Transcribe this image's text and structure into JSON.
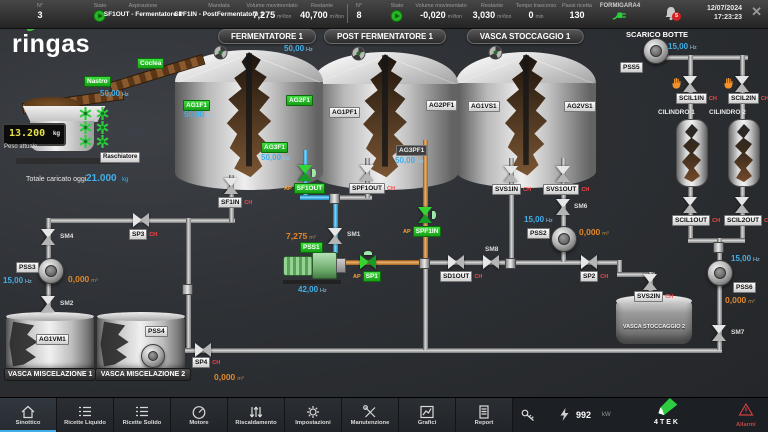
{
  "colors": {
    "accent_blue": "#42aee8",
    "valve_open_green": "#2ecc40",
    "value_orange": "#e0872a",
    "alarm_red": "#e03131"
  },
  "header": {
    "left": {
      "n_label": "N°",
      "n": "3",
      "stato_label": "Stato",
      "aspirazione_label": "Aspirazione",
      "aspirazione": "SF1OUT - Fermentatore 1",
      "mandata_label": "Mandata",
      "mandata": "SPF1IN - PostFermentatore 1",
      "volume_label": "Volume movimentato",
      "volume": "7,275",
      "volume_unit": "m³/ton",
      "restante_label": "Restante",
      "restante": "40,700",
      "restante_unit": "m³/ton"
    },
    "right": {
      "n_label": "N°",
      "n": "8",
      "stato_label": "Stato",
      "volume_label": "Volume movimentato",
      "volume": "-0,020",
      "volume_unit": "m³/ton",
      "restante_label": "Restante",
      "restante": "3,030",
      "restante_unit": "m³/ton",
      "tempo_label": "Tempo trascorso",
      "tempo": "0",
      "tempo_unit": "min",
      "passi_label": "Passi ricetta",
      "passi": "130"
    },
    "station": "FORMIGARA4",
    "alarm_count": "5",
    "date": "12/07/2024",
    "time": "17:23:23"
  },
  "logo": "ringas",
  "feeder": {
    "coclea": "Coclea",
    "nastro": "Nastro",
    "hz": "50,00",
    "hz_unit": "Hz",
    "peso": "13.200",
    "peso_unit": "kg",
    "peso_label": "Peso attuale",
    "raschiatore": "Raschiatore",
    "totale_label": "Totale caricato oggi",
    "totale": "21.000",
    "totale_unit": "kg"
  },
  "tanks": {
    "f1": {
      "title": "FERMENTATORE 1",
      "ag1": "AG1F1",
      "ag1_hz": "50,00",
      "ag2": "AG2F1",
      "ag2_hz": "50,00",
      "ag3": "AG3F1",
      "ag3_hz": "50,00",
      "hz_unit": "Hz"
    },
    "pf1": {
      "title": "POST FERMENTATORE 1",
      "ag1": "AG1PF1",
      "ag2": "AG2PF1",
      "ag3": "AG3PF1",
      "ag3_hz": "50,00",
      "hz_unit": "Hz"
    },
    "vs1": {
      "title": "VASCA STOCCAGGIO 1",
      "ag1": "AG1VS1",
      "ag2": "AG2VS1"
    },
    "vs2": {
      "title": "VASCA STOCCAGGIO 2"
    },
    "vm1": {
      "title": "VASCA MISCELAZIONE 1",
      "ag1": "AG1VM1"
    },
    "vm2": {
      "title": "VASCA MISCELAZIONE 2"
    },
    "scarico": {
      "title": "SCARICO BOTTE"
    },
    "cil1": "CILINDRO 1",
    "cil2": "CILINDRO 2"
  },
  "valves": {
    "sf1in": {
      "label": "SF1IN",
      "state": "CH"
    },
    "sf1out": {
      "label": "SF1OUT",
      "state": "AP"
    },
    "spf1out": {
      "label": "SPF1OUT",
      "state": "CH"
    },
    "sm1": {
      "label": "SM1"
    },
    "sp1": {
      "label": "SP1",
      "state": "AP"
    },
    "spf1in": {
      "label": "SPF1IN",
      "state": "AP"
    },
    "sd1out": {
      "label": "SD1OUT",
      "state": "CH"
    },
    "sm8": {
      "label": "SM8"
    },
    "svs1in": {
      "label": "SVS1IN",
      "state": "CH"
    },
    "svs1out": {
      "label": "SVS1OUT",
      "state": "CH"
    },
    "sm6": {
      "label": "SM6"
    },
    "sp2": {
      "label": "SP2",
      "state": "CH"
    },
    "svs2in": {
      "label": "SVS2IN",
      "state": "CH"
    },
    "sm7": {
      "label": "SM7"
    },
    "sp3": {
      "label": "SP3",
      "state": "CH"
    },
    "sm4": {
      "label": "SM4"
    },
    "sm2": {
      "label": "SM2"
    },
    "sp4": {
      "label": "SP4",
      "state": "CH"
    },
    "scil1in": {
      "label": "SCIL1IN",
      "state": "CH"
    },
    "scil2in": {
      "label": "SCIL2IN",
      "state": "CH"
    },
    "scil1out": {
      "label": "SCIL1OUT",
      "state": "CH"
    },
    "scil2out": {
      "label": "SCIL2OUT",
      "state": "CH"
    }
  },
  "pumps": {
    "pss1": {
      "label": "PSS1",
      "hz": "42,00",
      "hz_unit": "Hz",
      "vol": "7,275",
      "vol_unit": "m³"
    },
    "pss2": {
      "label": "PSS2",
      "hz": "15,00",
      "hz_unit": "Hz",
      "vol": "0,000",
      "vol_unit": "m³"
    },
    "pss3": {
      "label": "PSS3",
      "hz": "15,00",
      "hz_unit": "Hz",
      "vol": "0,000",
      "vol_unit": "m³"
    },
    "pss4": {
      "label": "PSS4",
      "vol": "0,000",
      "vol_unit": "m³"
    },
    "pss5": {
      "label": "PSS5",
      "hz": "15,00",
      "hz_unit": "Hz"
    },
    "pss6": {
      "label": "PSS6",
      "hz": "15,00",
      "hz_unit": "Hz",
      "vol": "0,000",
      "vol_unit": "m³"
    }
  },
  "nav": {
    "items": [
      "Sinottico",
      "Ricette Liquido",
      "Ricette Solido",
      "Motore",
      "Riscaldamento",
      "Impostazioni",
      "Manutenzione",
      "Grafici",
      "Report"
    ],
    "power": "992",
    "power_unit": "kW",
    "brand": "4TEK",
    "allarmi": "Allarmi"
  }
}
